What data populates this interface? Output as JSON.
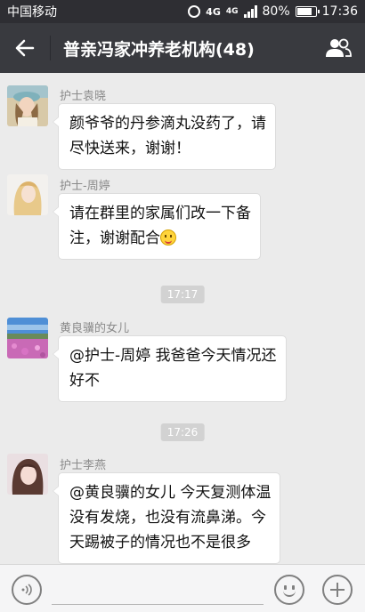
{
  "status_bar": {
    "carrier": "中国移动",
    "network": "4G",
    "network2": "4G",
    "battery": "80%",
    "battery_level": 0.8,
    "time": "17:36"
  },
  "header": {
    "back_icon": "back-arrow-icon",
    "title": "普亲冯家冲养老机构(48)",
    "members_icon": "group-members-icon"
  },
  "messages": [
    {
      "sender": "护士袁晓",
      "lines": [
        "颜爷爷的丹参滴丸没药了，请",
        "尽快送来，谢谢！"
      ],
      "avatar": "avatar-girl-hat"
    },
    {
      "sender": "护士-周婷",
      "lines": [
        "请在群里的家属们改一下备",
        "注，谢谢配合"
      ],
      "emoji": "smiley-icon",
      "avatar": "avatar-girl-blonde"
    },
    {
      "time": "17:17"
    },
    {
      "sender": "黄良骥的女儿",
      "lines": [
        "@护士-周婷 我爸爸今天情况还",
        "好不"
      ],
      "avatar": "avatar-flower-field"
    },
    {
      "time": "17:26"
    },
    {
      "sender": "护士李燕",
      "lines": [
        "@黄良骥的女儿 今天复测体温",
        "没有发烧，也没有流鼻涕。今",
        "天踢被子的情况也不是很多"
      ],
      "avatar": "avatar-girl-portrait"
    }
  ],
  "input_bar": {
    "voice_icon": "voice-icon",
    "emoji_icon": "emoji-icon",
    "plus_icon": "plus-icon"
  }
}
